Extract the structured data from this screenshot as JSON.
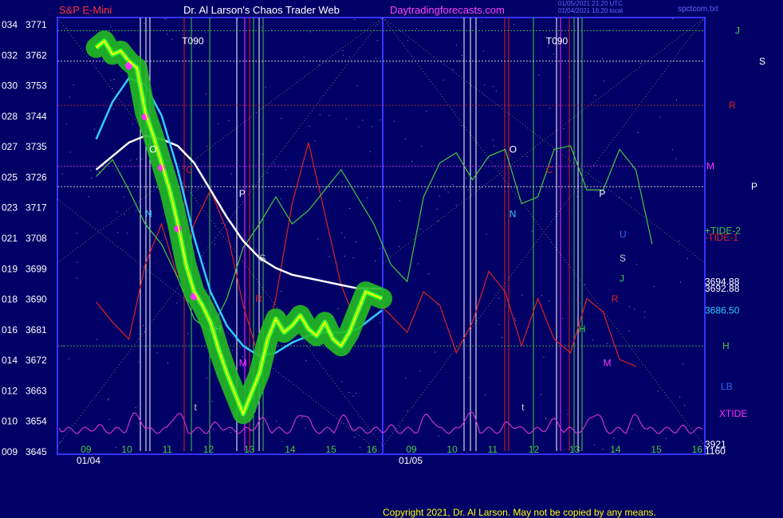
{
  "header": {
    "instrument": "S&P E-Mini",
    "title": "Dr. Al Larson's Chaos Trader Web",
    "site": "Daytradingforecasts.com",
    "timestamp_1": "01/05/2021 21:20 UTC",
    "timestamp_2": "01/04/2021 16:20 local",
    "file": "spctcom.txt"
  },
  "footer": {
    "copyright": "Copyright 2021, Dr. Al Larson. May not be copied by any means."
  },
  "colors": {
    "background": "#000066",
    "frame": "#3333ff",
    "price_yellow": "#ffff00",
    "ma_cyan": "#33ccff",
    "ma_white": "#ffffff",
    "green_highlight": "#22bb22",
    "magenta_dots": "#ff33ff",
    "tide_green": "#44cc44",
    "tide_red": "#dd2222",
    "xtide_magenta": "#cc33cc"
  },
  "chart_data": {
    "type": "line",
    "ylabel": "",
    "xlabel": "",
    "ylim": [
      3645,
      3771
    ],
    "y_ticks": [
      {
        "left": "034",
        "price": "3771"
      },
      {
        "left": "032",
        "price": "3762"
      },
      {
        "left": "030",
        "price": "3753"
      },
      {
        "left": "028",
        "price": "3744"
      },
      {
        "left": "027",
        "price": "3735"
      },
      {
        "left": "025",
        "price": "3726"
      },
      {
        "left": "023",
        "price": "3717"
      },
      {
        "left": "021",
        "price": "3708"
      },
      {
        "left": "019",
        "price": "3699"
      },
      {
        "left": "018",
        "price": "3690"
      },
      {
        "left": "016",
        "price": "3681"
      },
      {
        "left": "014",
        "price": "3672"
      },
      {
        "left": "012",
        "price": "3663"
      },
      {
        "left": "010",
        "price": "3654"
      },
      {
        "left": "009",
        "price": "3645"
      }
    ],
    "x_hours": [
      "09",
      "10",
      "11",
      "12",
      "13",
      "14",
      "15",
      "16",
      "09",
      "10",
      "11",
      "12",
      "13",
      "14",
      "15",
      "16"
    ],
    "x_dates": [
      "01/04",
      "01/05"
    ],
    "series": [
      {
        "values": [
          [
            9.0,
            3764
          ],
          [
            9.2,
            3766
          ],
          [
            9.4,
            3762
          ],
          [
            9.6,
            3763
          ],
          [
            9.8,
            3760
          ],
          [
            10.0,
            3758
          ],
          [
            10.2,
            3745
          ],
          [
            10.4,
            3738
          ],
          [
            10.6,
            3730
          ],
          [
            10.8,
            3722
          ],
          [
            11.0,
            3712
          ],
          [
            11.2,
            3700
          ],
          [
            11.4,
            3692
          ],
          [
            11.6,
            3688
          ],
          [
            11.8,
            3683
          ],
          [
            12.0,
            3675
          ],
          [
            12.2,
            3668
          ],
          [
            12.4,
            3662
          ],
          [
            12.6,
            3656
          ],
          [
            12.8,
            3662
          ],
          [
            13.0,
            3668
          ],
          [
            13.2,
            3678
          ],
          [
            13.4,
            3684
          ],
          [
            13.6,
            3680
          ],
          [
            13.8,
            3682
          ],
          [
            14.0,
            3685
          ],
          [
            14.2,
            3681
          ],
          [
            14.4,
            3679
          ],
          [
            14.6,
            3683
          ],
          [
            14.8,
            3678
          ],
          [
            15.0,
            3676
          ],
          [
            15.2,
            3680
          ],
          [
            15.4,
            3686
          ],
          [
            15.6,
            3692
          ],
          [
            15.8,
            3691
          ],
          [
            16.0,
            3690
          ]
        ]
      },
      {
        "values": [
          [
            9.0,
            3737
          ],
          [
            9.4,
            3748
          ],
          [
            9.8,
            3755
          ],
          [
            10.2,
            3753
          ],
          [
            10.6,
            3744
          ],
          [
            11.0,
            3728
          ],
          [
            11.4,
            3708
          ],
          [
            11.8,
            3692
          ],
          [
            12.2,
            3682
          ],
          [
            12.6,
            3676
          ],
          [
            13.0,
            3673
          ],
          [
            13.4,
            3674
          ],
          [
            13.8,
            3677
          ],
          [
            14.2,
            3679
          ],
          [
            14.6,
            3680
          ],
          [
            15.0,
            3680
          ],
          [
            15.4,
            3681
          ],
          [
            16.0,
            3686.5
          ]
        ]
      },
      {
        "values": [
          [
            9.0,
            3728
          ],
          [
            9.4,
            3732
          ],
          [
            9.8,
            3736
          ],
          [
            10.2,
            3738
          ],
          [
            10.6,
            3737
          ],
          [
            11.0,
            3735
          ],
          [
            11.4,
            3730
          ],
          [
            11.8,
            3722
          ],
          [
            12.2,
            3714
          ],
          [
            12.6,
            3707
          ],
          [
            13.0,
            3702
          ],
          [
            13.4,
            3699
          ],
          [
            13.8,
            3697
          ],
          [
            14.2,
            3696
          ],
          [
            14.6,
            3695
          ],
          [
            15.0,
            3694
          ],
          [
            15.4,
            3693
          ],
          [
            16.0,
            3692.9
          ]
        ]
      },
      {
        "values": [
          [
            9.0,
            3726
          ],
          [
            9.4,
            3731
          ],
          [
            9.8,
            3722
          ],
          [
            10.2,
            3712
          ],
          [
            10.6,
            3706
          ],
          [
            11.0,
            3696
          ],
          [
            11.4,
            3684
          ],
          [
            11.8,
            3680
          ],
          [
            12.2,
            3690
          ],
          [
            12.6,
            3705
          ],
          [
            13.0,
            3712
          ],
          [
            13.4,
            3720
          ],
          [
            13.8,
            3712
          ],
          [
            14.2,
            3716
          ],
          [
            14.6,
            3722
          ],
          [
            15.0,
            3728
          ],
          [
            15.4,
            3720
          ],
          [
            15.8,
            3712
          ],
          [
            16.2,
            3700
          ],
          [
            16.6,
            3695
          ],
          [
            17.0,
            3720
          ],
          [
            17.4,
            3730
          ],
          [
            17.8,
            3733
          ],
          [
            18.2,
            3725
          ],
          [
            18.6,
            3732
          ],
          [
            19.0,
            3734
          ],
          [
            19.4,
            3718
          ],
          [
            19.8,
            3720
          ],
          [
            20.2,
            3734
          ],
          [
            20.6,
            3735
          ],
          [
            21.0,
            3722
          ],
          [
            21.4,
            3722
          ],
          [
            21.8,
            3734
          ],
          [
            22.2,
            3728
          ],
          [
            22.6,
            3706
          ]
        ]
      },
      {
        "values": [
          [
            9.0,
            3689
          ],
          [
            9.4,
            3683
          ],
          [
            9.8,
            3678
          ],
          [
            10.2,
            3700
          ],
          [
            10.6,
            3712
          ],
          [
            11.0,
            3696
          ],
          [
            11.4,
            3712
          ],
          [
            11.8,
            3722
          ],
          [
            12.2,
            3710
          ],
          [
            12.6,
            3688
          ],
          [
            13.0,
            3672
          ],
          [
            13.4,
            3690
          ],
          [
            13.8,
            3718
          ],
          [
            14.2,
            3736
          ],
          [
            14.6,
            3715
          ],
          [
            15.0,
            3694
          ],
          [
            15.4,
            3682
          ],
          [
            15.8,
            3690
          ],
          [
            16.2,
            3685
          ],
          [
            16.6,
            3680
          ],
          [
            17.0,
            3692
          ],
          [
            17.4,
            3688
          ],
          [
            17.8,
            3674
          ],
          [
            18.2,
            3683
          ],
          [
            18.6,
            3698
          ],
          [
            19.0,
            3692
          ],
          [
            19.4,
            3676
          ],
          [
            19.8,
            3690
          ],
          [
            20.2,
            3678
          ],
          [
            20.6,
            3674
          ],
          [
            21.0,
            3690
          ],
          [
            21.4,
            3686
          ],
          [
            21.8,
            3672
          ],
          [
            22.2,
            3670
          ]
        ]
      }
    ],
    "level_lines": [
      {
        "label": "J",
        "price": 3769
      },
      {
        "label": "S",
        "price": 3760
      },
      {
        "label": "R",
        "price": 3747
      },
      {
        "label": "M",
        "price": 3729
      },
      {
        "label": "P",
        "price": 3723
      },
      {
        "label": "H",
        "price": 3676
      },
      {
        "label": "LB",
        "price": 3664
      },
      {
        "label": "XTIDE",
        "price": 3656
      }
    ],
    "right_labels": [
      {
        "text": "+TIDE-2",
        "price": 3710
      },
      {
        "text": "-TIDE-1",
        "price": 3708
      },
      {
        "text": "3694.88",
        "price": 3695
      },
      {
        "text": "3692.88",
        "price": 3693
      },
      {
        "text": "3686.50",
        "price": 3686.5
      },
      {
        "text": "3921",
        "price": 3647
      },
      {
        "text": "1160",
        "price": 3645
      }
    ],
    "markers": [
      {
        "text": "T090",
        "x": 11.1,
        "price": 3765
      },
      {
        "text": "T090",
        "x": 20.0,
        "price": 3765
      },
      {
        "text": "O",
        "x": 10.3,
        "price": 3733
      },
      {
        "text": "N",
        "x": 10.2,
        "price": 3714
      },
      {
        "text": "C",
        "x": 11.2,
        "price": 3727
      },
      {
        "text": "P",
        "x": 12.5,
        "price": 3720
      },
      {
        "text": "S",
        "x": 13.0,
        "price": 3701
      },
      {
        "text": "R",
        "x": 12.9,
        "price": 3689
      },
      {
        "text": "H",
        "x": 11.9,
        "price": 3680
      },
      {
        "text": "M",
        "x": 12.5,
        "price": 3670
      },
      {
        "text": "t",
        "x": 11.4,
        "price": 3657
      },
      {
        "text": "O",
        "x": 19.1,
        "price": 3733
      },
      {
        "text": "N",
        "x": 19.1,
        "price": 3714
      },
      {
        "text": "C",
        "x": 20.0,
        "price": 3727
      },
      {
        "text": "P",
        "x": 21.3,
        "price": 3720
      },
      {
        "text": "U",
        "x": 21.8,
        "price": 3708
      },
      {
        "text": "S",
        "x": 21.8,
        "price": 3701
      },
      {
        "text": "J",
        "x": 21.8,
        "price": 3695
      },
      {
        "text": "R",
        "x": 21.6,
        "price": 3689
      },
      {
        "text": "H",
        "x": 20.8,
        "price": 3680
      },
      {
        "text": "M",
        "x": 21.4,
        "price": 3670
      },
      {
        "text": "t",
        "x": 19.4,
        "price": 3657
      }
    ]
  }
}
